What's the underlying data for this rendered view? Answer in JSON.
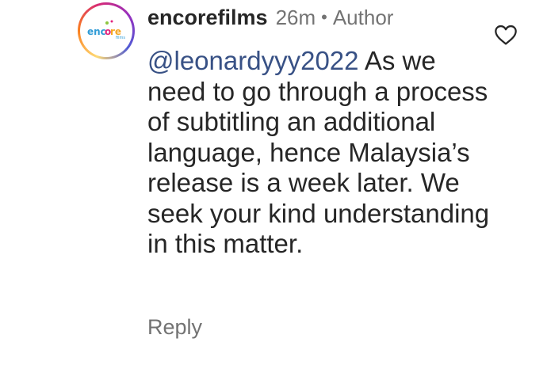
{
  "comment": {
    "avatar": {
      "logo_text": "encore",
      "logo_sub": "films"
    },
    "username": "encorefilms",
    "time": "26m",
    "separator": "•",
    "role": "Author",
    "mention": "@leonardyyy2022",
    "text": "As we need to go through a process of subtitling an additional language, hence Malaysia’s release is a week later. We seek your kind understanding in this matter.",
    "reply_label": "Reply",
    "like_icon": "heart-outline-icon"
  },
  "colors": {
    "text": "#262626",
    "secondary": "#737373",
    "mention": "#385185"
  }
}
